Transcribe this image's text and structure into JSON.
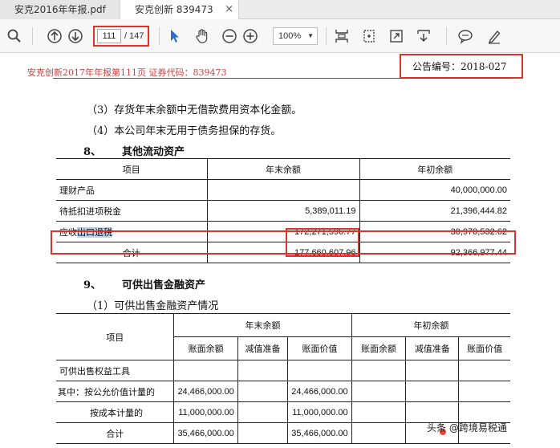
{
  "tabs": [
    {
      "label": "安克2016年年报.pdf"
    },
    {
      "label": "安克创新 839473",
      "close": "×"
    }
  ],
  "toolbar": {
    "page_current": "111",
    "page_total": "/ 147",
    "zoom": "100%",
    "icons": [
      "search-icon",
      "page-up-icon",
      "page-down-icon",
      "select-cursor-icon",
      "hand-tool-icon",
      "zoom-out-icon",
      "zoom-in-icon",
      "fit-page-icon",
      "rotate-icon",
      "fullscreen-icon",
      "annotate-icon",
      "comment-icon",
      "highlight-pen-icon"
    ]
  },
  "doc": {
    "header_left": "安克创新2017年年报第111页    证券代码：839473",
    "header_right": "公告编号：2018-027",
    "para1": "（3）存货年末余额中无借款费用资本化金额。",
    "para2": "（4）本公司年末无用于债务担保的存货。",
    "section8_num": "8、",
    "section8_title": "其他流动资产",
    "table1": {
      "headers": [
        "项目",
        "年末余额",
        "年初余额"
      ],
      "rows": [
        {
          "item": "理财产品",
          "end": "",
          "start": "40,000,000.00"
        },
        {
          "item": "待抵扣进项税金",
          "end": "5,389,011.19",
          "start": "21,396,444.82"
        },
        {
          "item_prefix": "应收",
          "item_hl": "出口退税",
          "end": "172,271,596.77",
          "start": "30,970,532.62"
        },
        {
          "item": "合计",
          "end": "177,660,607.96",
          "start": "92,366,977.44"
        }
      ]
    },
    "section9_num": "9、",
    "section9_title": "可供出售金融资产",
    "sub9_1": "（1）可供出售金融资产情况",
    "table2": {
      "col_item": "项目",
      "group_end": "年末余额",
      "group_start": "年初余额",
      "subheaders": [
        "账面余额",
        "减值准备",
        "账面价值",
        "账面余额",
        "减值准备",
        "账面价值"
      ],
      "rows": [
        {
          "item": "可供出售权益工具",
          "v": [
            "",
            "",
            "",
            "",
            "",
            ""
          ]
        },
        {
          "item": "其中：按公允价值计量的",
          "v": [
            "24,466,000.00",
            "",
            "24,466,000.00",
            "",
            "",
            ""
          ]
        },
        {
          "item": "按成本计量的",
          "v": [
            "11,000,000.00",
            "",
            "11,000,000.00",
            "",
            "",
            ""
          ]
        },
        {
          "item": "合计",
          "v": [
            "35,466,000.00",
            "",
            "35,466,000.00",
            "",
            "",
            ""
          ]
        }
      ]
    },
    "watermark": "头条 @跨境易税通"
  },
  "colors": {
    "annotation_red": "#d9342b",
    "selection_blue": "#b8d2ec",
    "header_red": "#d04040"
  }
}
